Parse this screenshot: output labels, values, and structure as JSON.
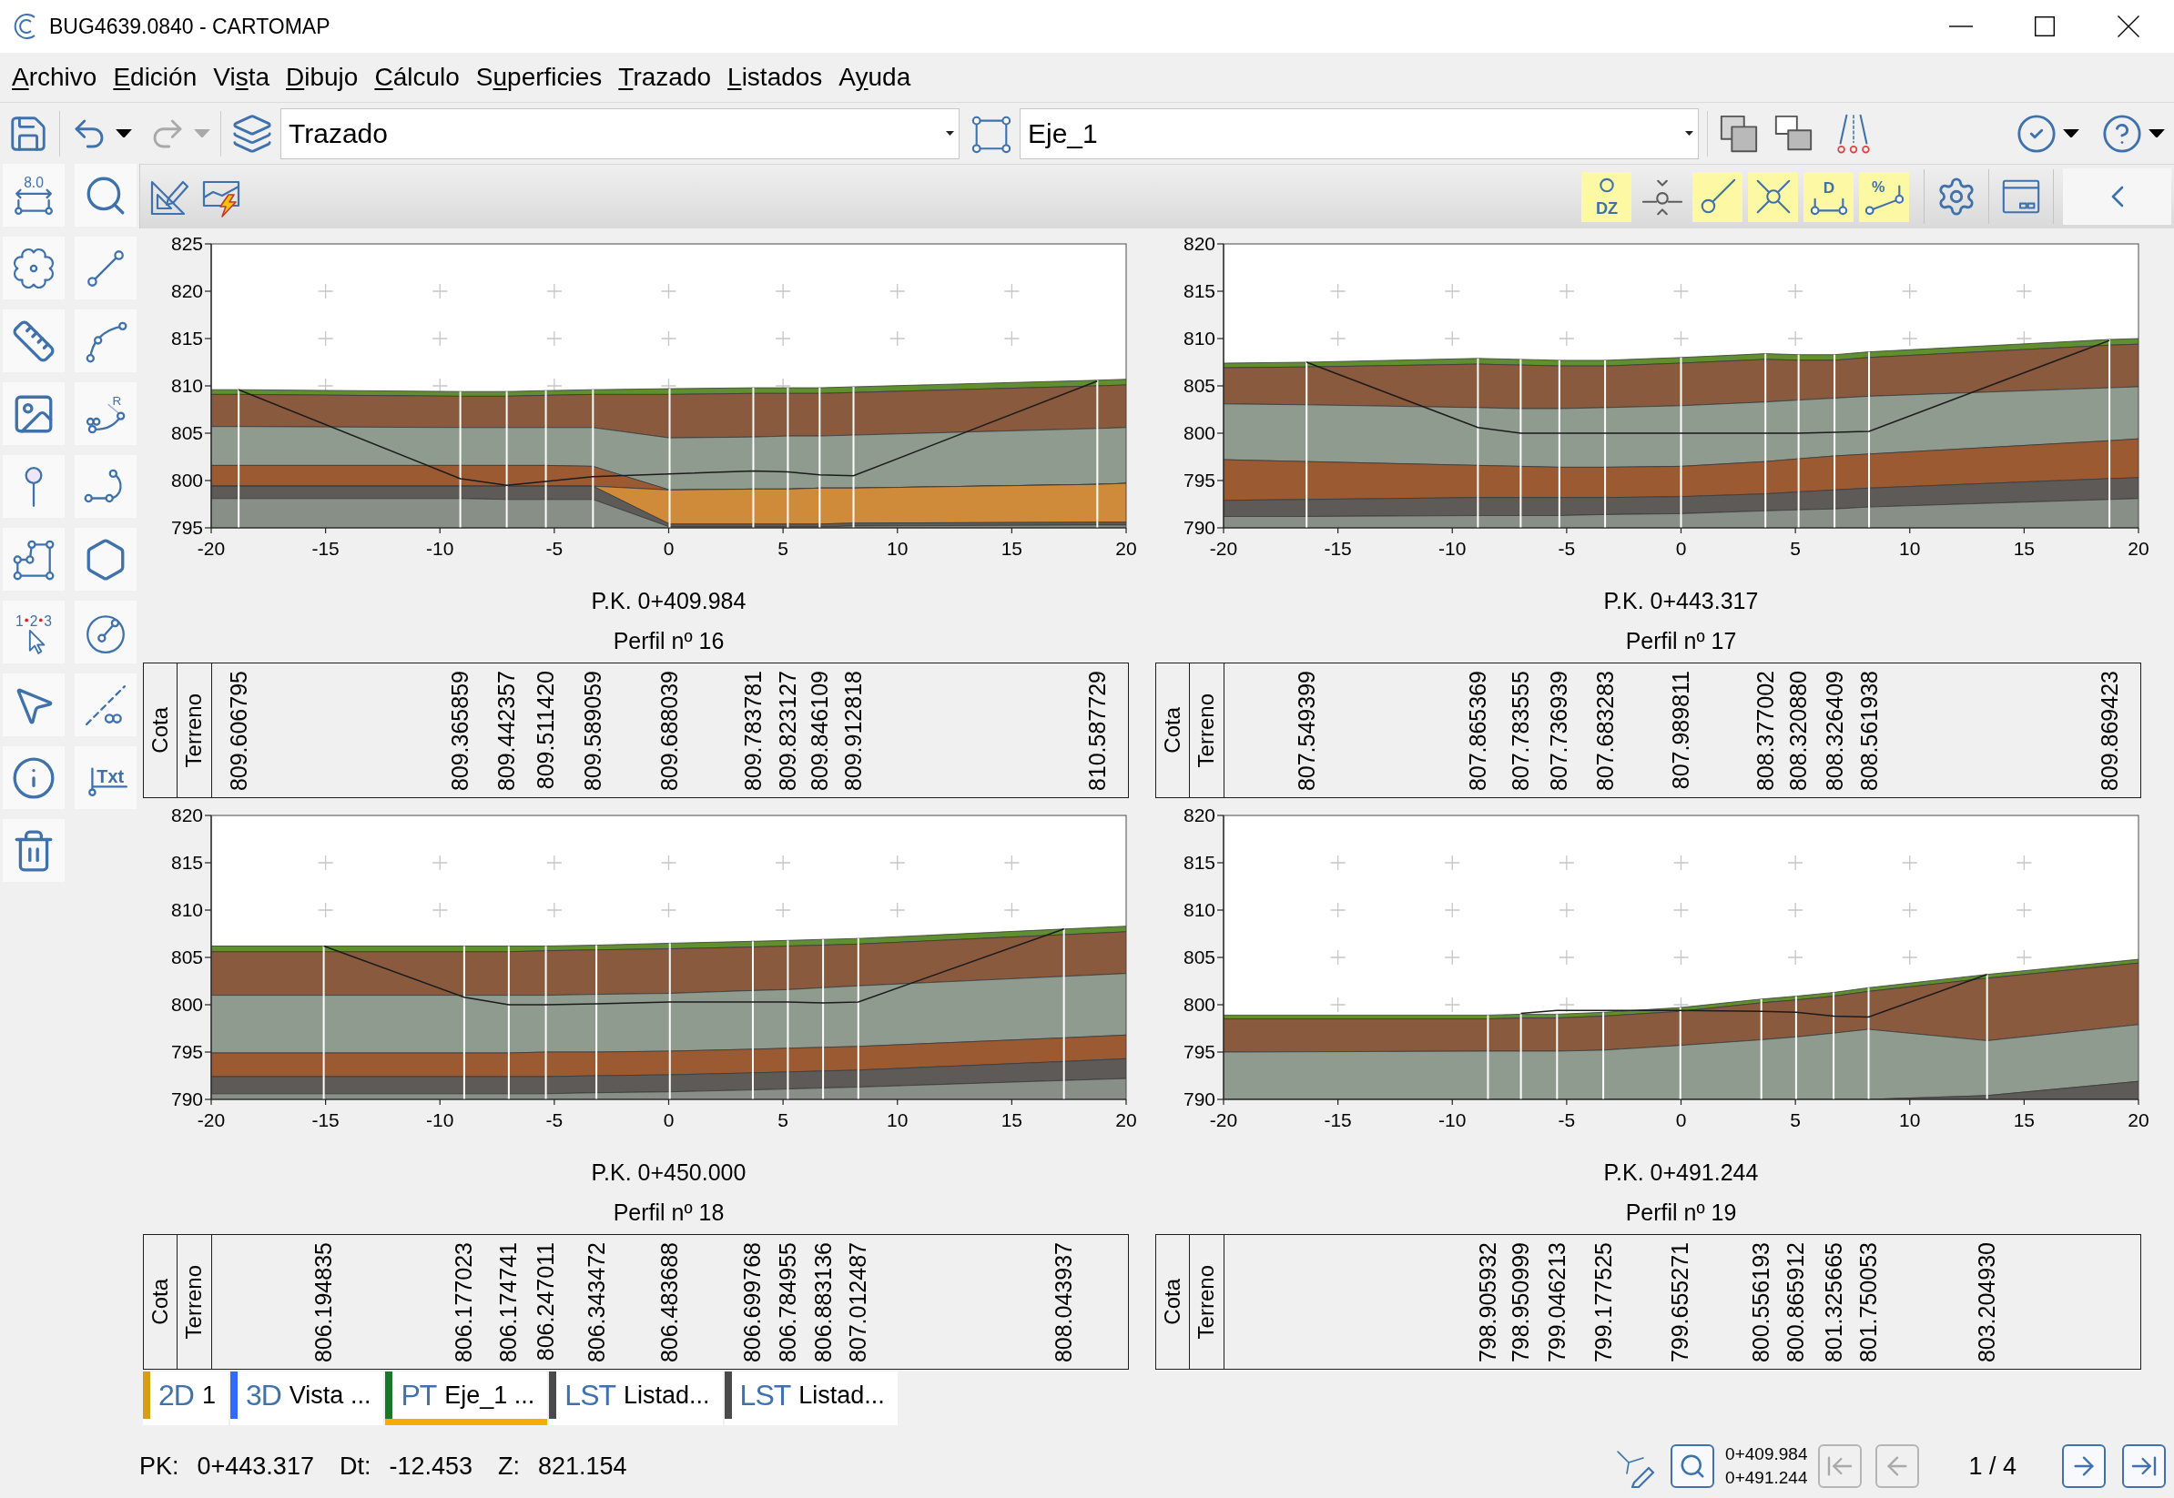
{
  "window": {
    "title": "BUG4639.0840 - CARTOMAP"
  },
  "menu": [
    {
      "key": "A",
      "rest": "rchivo"
    },
    {
      "key": "E",
      "rest": "dición"
    },
    {
      "lead": "Vi",
      "key": "s",
      "rest": "ta"
    },
    {
      "key": "D",
      "rest": "ibujo"
    },
    {
      "key": "C",
      "rest": "álculo"
    },
    {
      "lead": "S",
      "key": "u",
      "rest": "perficies"
    },
    {
      "key": "T",
      "rest": "razado"
    },
    {
      "key": "L",
      "rest": "istados"
    },
    {
      "lead": "A",
      "key": "y",
      "rest": "uda"
    }
  ],
  "toolbar": {
    "undo": {
      "disabled": false
    },
    "redo": {
      "disabled": true
    },
    "layer_combo": {
      "value": "Trazado"
    },
    "axis_combo": {
      "value": "Eje_1"
    }
  },
  "tools": [
    {
      "kind": "dimension",
      "label": "8.0"
    },
    {
      "kind": "zoom"
    },
    {
      "kind": "region"
    },
    {
      "kind": "line"
    },
    {
      "kind": "ruler"
    },
    {
      "kind": "arc"
    },
    {
      "kind": "image"
    },
    {
      "kind": "clothoid",
      "label": "R"
    },
    {
      "kind": "pin"
    },
    {
      "kind": "hook"
    },
    {
      "kind": "polyline"
    },
    {
      "kind": "hexagon"
    },
    {
      "kind": "numbering",
      "digits": [
        "1",
        "2",
        "3"
      ]
    },
    {
      "kind": "circle"
    },
    {
      "kind": "pointer"
    },
    {
      "kind": "infinite_line"
    },
    {
      "kind": "info"
    },
    {
      "kind": "text",
      "label": "Txt"
    },
    {
      "kind": "trash"
    }
  ],
  "profile_toolbar": {
    "toggles": [
      {
        "kind": "dz",
        "label": "DZ",
        "on": true
      },
      {
        "kind": "node",
        "on": false
      },
      {
        "kind": "tangent",
        "on": true
      },
      {
        "kind": "cross",
        "on": true
      },
      {
        "kind": "distance",
        "label": "D",
        "on": true
      },
      {
        "kind": "slope",
        "label": "%",
        "on": true
      }
    ]
  },
  "profiles": [
    {
      "chart_data": {
        "type": "area",
        "xlim": [
          -20,
          20
        ],
        "ylim": [
          795,
          825
        ],
        "xticks": [
          -20,
          -15,
          -10,
          -5,
          0,
          5,
          10,
          15,
          20
        ],
        "yticks": [
          795,
          800,
          805,
          810,
          815,
          820,
          825
        ],
        "x": [
          -20,
          -18.8,
          -9.11,
          -7.08,
          -5.37,
          -3.31,
          0.04,
          3.7,
          5.21,
          6.6,
          8.08,
          18.74,
          20
        ],
        "series": [
          {
            "color": "#5f8f2e",
            "values": [
              809.6,
              809.6,
              809.4,
              809.4,
              809.5,
              809.6,
              809.7,
              809.8,
              809.8,
              809.8,
              809.9,
              810.6,
              810.7
            ]
          },
          {
            "color": "#8a5a3e",
            "values": [
              809.1,
              809.1,
              808.9,
              808.9,
              809.0,
              809.1,
              809.1,
              809.2,
              809.2,
              809.2,
              809.3,
              810.0,
              810.1
            ]
          },
          {
            "color": "#8f9b8f",
            "values": [
              805.7,
              805.7,
              805.6,
              805.6,
              805.6,
              805.6,
              804.5,
              804.6,
              804.7,
              804.7,
              804.8,
              805.5,
              805.6
            ]
          },
          {
            "color": "#9c5a32",
            "values": [
              801.6,
              801.6,
              801.6,
              801.6,
              801.6,
              801.5,
              799.0,
              799.1,
              799.1,
              799.2,
              799.2,
              799.6,
              799.7
            ]
          },
          {
            "color": "#cf8a3a",
            "values": [
              799.4,
              799.4,
              799.4,
              799.4,
              799.4,
              799.4,
              799.0,
              799.1,
              799.1,
              799.2,
              799.2,
              799.6,
              799.7
            ]
          },
          {
            "color": "#5e5a57",
            "values": [
              799.4,
              799.4,
              799.4,
              799.4,
              799.4,
              799.4,
              795.4,
              795.4,
              795.4,
              795.4,
              795.5,
              795.6,
              795.6
            ]
          },
          {
            "color": "#878f86",
            "values": [
              798.1,
              798.1,
              798.1,
              798.0,
              798.0,
              798.0,
              795.1,
              795.1,
              795.1,
              795.1,
              795.2,
              795.3,
              795.3
            ]
          },
          {
            "type": "line",
            "color": "#1c1c1c",
            "values": [
              null,
              809.6,
              800.2,
              799.5,
              799.9,
              800.4,
              800.7,
              801.0,
              800.9,
              800.6,
              800.5,
              810.5,
              null
            ]
          },
          {
            "type": "bar",
            "color": "#ffffff",
            "values": [
              null,
              809.6,
              809.4,
              809.4,
              809.5,
              809.6,
              809.7,
              809.8,
              809.8,
              809.8,
              809.9,
              810.6,
              null
            ]
          }
        ]
      },
      "pk": "P.K. 0+409.984",
      "title": "Perfil nº 16",
      "table": {
        "headers": [
          "Cota",
          "Terreno"
        ],
        "values": [
          "809.606795",
          "809.365859",
          "809.442357",
          "809.511420",
          "809.589059",
          "809.688039",
          "809.783781",
          "809.823127",
          "809.846109",
          "809.912818",
          "810.587729"
        ]
      }
    },
    {
      "chart_data": {
        "type": "area",
        "xlim": [
          -20,
          20
        ],
        "ylim": [
          790,
          820
        ],
        "xticks": [
          -20,
          -15,
          -10,
          -5,
          0,
          5,
          10,
          15,
          20
        ],
        "yticks": [
          790,
          795,
          800,
          805,
          810,
          815,
          820
        ],
        "x": [
          -20,
          -16.37,
          -8.88,
          -7.01,
          -5.32,
          -3.32,
          0,
          3.69,
          5.14,
          6.71,
          8.22,
          18.73,
          20
        ],
        "series": [
          {
            "color": "#5f8f2e",
            "values": [
              807.4,
              807.5,
              807.9,
              807.8,
              807.7,
              807.7,
              808.0,
              808.4,
              808.3,
              808.3,
              808.6,
              809.9,
              810.0
            ]
          },
          {
            "color": "#8a5a3e",
            "values": [
              806.9,
              807.0,
              807.3,
              807.2,
              807.1,
              807.1,
              807.4,
              807.8,
              807.7,
              807.7,
              808.0,
              809.3,
              809.4
            ]
          },
          {
            "color": "#8f9b8f",
            "values": [
              803.1,
              803.0,
              802.7,
              802.6,
              802.6,
              802.7,
              802.9,
              803.3,
              803.5,
              803.7,
              803.9,
              804.8,
              804.9
            ]
          },
          {
            "color": "#9c5a32",
            "values": [
              797.2,
              797.0,
              796.6,
              796.5,
              796.4,
              796.4,
              796.5,
              797.0,
              797.3,
              797.6,
              797.8,
              799.2,
              799.4
            ]
          },
          {
            "color": "#5e5a57",
            "values": [
              792.9,
              793.0,
              793.2,
              793.2,
              793.2,
              793.2,
              793.3,
              793.6,
              793.8,
              794.0,
              794.2,
              795.2,
              795.3
            ]
          },
          {
            "color": "#878f86",
            "values": [
              791.2,
              791.2,
              791.3,
              791.3,
              791.3,
              791.4,
              791.5,
              791.8,
              791.9,
              792.0,
              792.2,
              793.0,
              793.1
            ]
          },
          {
            "type": "line",
            "color": "#1c1c1c",
            "values": [
              null,
              807.5,
              800.6,
              800.0,
              800.0,
              800.0,
              800.0,
              800.0,
              800.0,
              800.1,
              800.2,
              809.8,
              null
            ]
          },
          {
            "type": "bar",
            "color": "#ffffff",
            "values": [
              null,
              807.5,
              807.9,
              807.8,
              807.7,
              807.7,
              808.0,
              808.4,
              808.3,
              808.3,
              808.6,
              809.9,
              null
            ]
          }
        ]
      },
      "pk": "P.K. 0+443.317",
      "title": "Perfil nº 17",
      "table": {
        "headers": [
          "Cota",
          "Terreno"
        ],
        "values": [
          "807.549399",
          "807.865369",
          "807.783555",
          "807.736939",
          "807.683283",
          "807.989811",
          "808.377002",
          "808.320880",
          "808.326409",
          "808.561938",
          "809.869423"
        ]
      }
    },
    {
      "chart_data": {
        "type": "area",
        "xlim": [
          -20,
          20
        ],
        "ylim": [
          790,
          820
        ],
        "xticks": [
          -20,
          -15,
          -10,
          -5,
          0,
          5,
          10,
          15,
          20
        ],
        "yticks": [
          790,
          795,
          800,
          805,
          810,
          815,
          820
        ],
        "x": [
          -20,
          -15.08,
          -8.94,
          -6.99,
          -5.37,
          -3.16,
          0.05,
          3.68,
          5.21,
          6.75,
          8.29,
          17.28,
          20
        ],
        "series": [
          {
            "color": "#5f8f2e",
            "values": [
              806.2,
              806.2,
              806.2,
              806.2,
              806.2,
              806.3,
              806.5,
              806.7,
              806.8,
              806.9,
              807.0,
              808.0,
              808.3
            ]
          },
          {
            "color": "#8a5a3e",
            "values": [
              805.6,
              805.6,
              805.6,
              805.6,
              805.7,
              805.8,
              805.9,
              806.1,
              806.2,
              806.3,
              806.4,
              807.4,
              807.7
            ]
          },
          {
            "color": "#8f9b8f",
            "values": [
              801.0,
              801.0,
              801.0,
              801.0,
              801.0,
              801.1,
              801.2,
              801.5,
              801.6,
              801.8,
              802.0,
              803.0,
              803.3
            ]
          },
          {
            "color": "#9c5a32",
            "values": [
              794.9,
              794.9,
              794.9,
              794.9,
              795.0,
              795.0,
              795.1,
              795.3,
              795.4,
              795.5,
              795.6,
              796.5,
              796.8
            ]
          },
          {
            "color": "#5e5a57",
            "values": [
              792.4,
              792.4,
              792.4,
              792.4,
              792.4,
              792.5,
              792.6,
              792.8,
              792.9,
              793.0,
              793.1,
              794.0,
              794.3
            ]
          },
          {
            "color": "#878f86",
            "values": [
              790.6,
              790.6,
              790.6,
              790.6,
              790.6,
              790.7,
              790.8,
              791.0,
              791.1,
              791.2,
              791.3,
              792.0,
              792.2
            ]
          },
          {
            "type": "line",
            "color": "#1c1c1c",
            "values": [
              null,
              806.2,
              800.8,
              800.0,
              800.0,
              800.1,
              800.3,
              800.3,
              800.3,
              800.2,
              800.3,
              808.0,
              null
            ]
          },
          {
            "type": "bar",
            "color": "#ffffff",
            "values": [
              null,
              806.2,
              806.2,
              806.2,
              806.2,
              806.3,
              806.5,
              806.7,
              806.8,
              806.9,
              807.0,
              808.0,
              null
            ]
          }
        ]
      },
      "pk": "P.K. 0+450.000",
      "title": "Perfil nº 18",
      "table": {
        "headers": [
          "Cota",
          "Terreno"
        ],
        "values": [
          "806.194835",
          "806.177023",
          "806.174741",
          "806.247011",
          "806.343472",
          "806.483688",
          "806.699768",
          "806.784955",
          "806.883136",
          "807.012487",
          "808.043937"
        ]
      }
    },
    {
      "chart_data": {
        "type": "area",
        "xlim": [
          -20,
          20
        ],
        "ylim": [
          790,
          820
        ],
        "xticks": [
          -20,
          -15,
          -10,
          -5,
          0,
          5,
          10,
          15,
          20
        ],
        "yticks": [
          790,
          795,
          800,
          805,
          810,
          815,
          820
        ],
        "x": [
          -20,
          -8.44,
          -7.0,
          -5.42,
          -3.4,
          -0.03,
          3.51,
          5.03,
          6.67,
          8.2,
          13.38,
          20
        ],
        "series": [
          {
            "color": "#5f8f2e",
            "values": [
              798.9,
              798.9,
              799.0,
              799.0,
              799.2,
              799.7,
              800.6,
              800.9,
              801.3,
              801.8,
              803.2,
              804.8
            ]
          },
          {
            "color": "#8a5a3e",
            "values": [
              798.5,
              798.5,
              798.6,
              798.6,
              798.8,
              799.3,
              800.2,
              800.5,
              800.9,
              801.4,
              802.8,
              804.4
            ]
          },
          {
            "color": "#8f9b8f",
            "values": [
              795.0,
              795.1,
              795.1,
              795.1,
              795.2,
              795.7,
              796.3,
              796.6,
              797.0,
              797.4,
              796.2,
              797.9
            ]
          },
          {
            "color": "#5e5a57",
            "values": [
              790.0,
              790.0,
              790.0,
              790.0,
              790.0,
              790.0,
              790.0,
              790.0,
              790.0,
              790.0,
              790.4,
              791.9
            ]
          },
          {
            "type": "line",
            "color": "#1c1c1c",
            "values": [
              null,
              null,
              799.1,
              799.4,
              799.4,
              799.4,
              799.3,
              799.2,
              798.8,
              798.7,
              803.2,
              null
            ]
          },
          {
            "type": "bar",
            "color": "#ffffff",
            "values": [
              null,
              798.9,
              799.0,
              799.0,
              799.2,
              799.7,
              800.6,
              800.9,
              801.3,
              801.8,
              803.2,
              null
            ]
          }
        ]
      },
      "pk": "P.K. 0+491.244",
      "title": "Perfil nº 19",
      "table": {
        "headers": [
          "Cota",
          "Terreno"
        ],
        "values": [
          "798.905932",
          "798.950999",
          "799.046213",
          "799.177525",
          "799.655271",
          "800.556193",
          "800.865912",
          "801.325665",
          "801.750053",
          "803.204930"
        ]
      }
    }
  ],
  "tabs": [
    {
      "prefix": "2D",
      "label": "1",
      "color": "#d69e10",
      "selected": false
    },
    {
      "prefix": "3D",
      "label": "Vista ...",
      "color": "#2f6bff",
      "selected": false
    },
    {
      "prefix": "PT",
      "label": "Eje_1 ...",
      "color": "#17782a",
      "selected": true
    },
    {
      "prefix": "LST",
      "label": "Listad...",
      "color": "#4a4a4a",
      "selected": false
    },
    {
      "prefix": "LST",
      "label": "Listad...",
      "color": "#4a4a4a",
      "selected": false
    }
  ],
  "status_bar": {
    "fields": [
      {
        "label": "PK:",
        "value": "0+443.317"
      },
      {
        "label": "Dt:",
        "value": "-12.453"
      },
      {
        "label": "Z:",
        "value": "821.154"
      }
    ],
    "range": [
      "0+409.984",
      "0+491.244"
    ],
    "nav_back": [
      {
        "kind": "first",
        "disabled": true
      },
      {
        "kind": "previous",
        "disabled": true
      }
    ],
    "page": "1 / 4",
    "nav_forward": [
      {
        "kind": "next",
        "disabled": false
      },
      {
        "kind": "last",
        "disabled": false
      }
    ]
  }
}
